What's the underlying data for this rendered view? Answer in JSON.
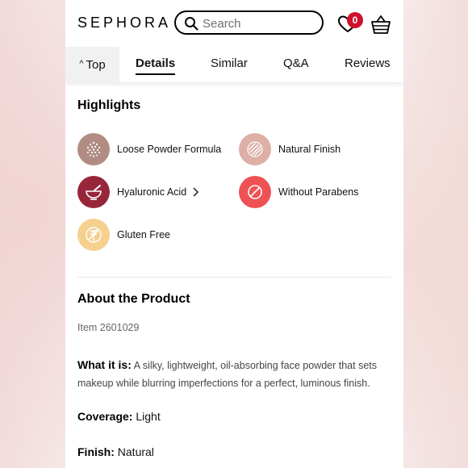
{
  "header": {
    "logo": "SEPHORA",
    "search_placeholder": "Search",
    "cart_badge": "0"
  },
  "tabs": {
    "top_label": "Top",
    "items": [
      "Details",
      "Similar",
      "Q&A",
      "Reviews"
    ],
    "active": "Details"
  },
  "highlights": {
    "title": "Highlights",
    "items": [
      {
        "label": "Loose Powder Formula",
        "icon": "powder-icon",
        "color": "#b08c82"
      },
      {
        "label": "Natural Finish",
        "icon": "natural-finish-icon",
        "color": "#ddafa6"
      },
      {
        "label": "Hyaluronic Acid",
        "icon": "mortar-bowl-icon",
        "color": "#98263a"
      },
      {
        "label": "Without Parabens",
        "icon": "prohibited-icon",
        "color": "#ef5254"
      },
      {
        "label": "Gluten Free",
        "icon": "gluten-free-icon",
        "color": "#f5d08f"
      }
    ]
  },
  "about": {
    "title": "About the Product",
    "item_number": "Item 2601029",
    "what_it_is_label": "What it is:",
    "what_it_is_text": "A silky, lightweight, oil-absorbing face powder that sets makeup while blurring imperfections for a perfect, luminous finish.",
    "coverage_label": "Coverage:",
    "coverage_value": "Light",
    "finish_label": "Finish:",
    "finish_value": "Natural"
  }
}
